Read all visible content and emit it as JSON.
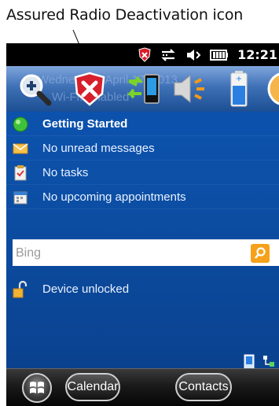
{
  "callout": {
    "caption": "Assured Radio Deactivation icon"
  },
  "status_bar": {
    "icons": [
      "radio-deactivation-icon",
      "connectivity-icon",
      "volume-mute-icon",
      "battery-icon"
    ],
    "time": "12:21"
  },
  "toolbar": {
    "ghost_line1": "Wednesday, April 17, 2013",
    "ghost_line2": "Wi-Fi: Enabled",
    "icons": [
      "zoom-icon",
      "radio-deactivation-shield-icon",
      "connection-manager-icon",
      "volume-icon",
      "battery-icon",
      "clock-icon"
    ]
  },
  "today": {
    "items": [
      {
        "label": "Getting Started",
        "icon": "getting-started-icon"
      },
      {
        "label": "No unread messages",
        "icon": "messages-icon"
      },
      {
        "label": "No tasks",
        "icon": "tasks-icon"
      },
      {
        "label": "No upcoming appointments",
        "icon": "calendar-icon"
      }
    ]
  },
  "search": {
    "placeholder": "Bing"
  },
  "device_status": {
    "label": "Device unlocked"
  },
  "taskbar": {
    "left_softkey": "Calendar",
    "right_softkey": "Contacts"
  },
  "colors": {
    "accent_blue": "#0b55b4",
    "shield_red": "#d71f2b",
    "bing_orange": "#f6a11a"
  }
}
